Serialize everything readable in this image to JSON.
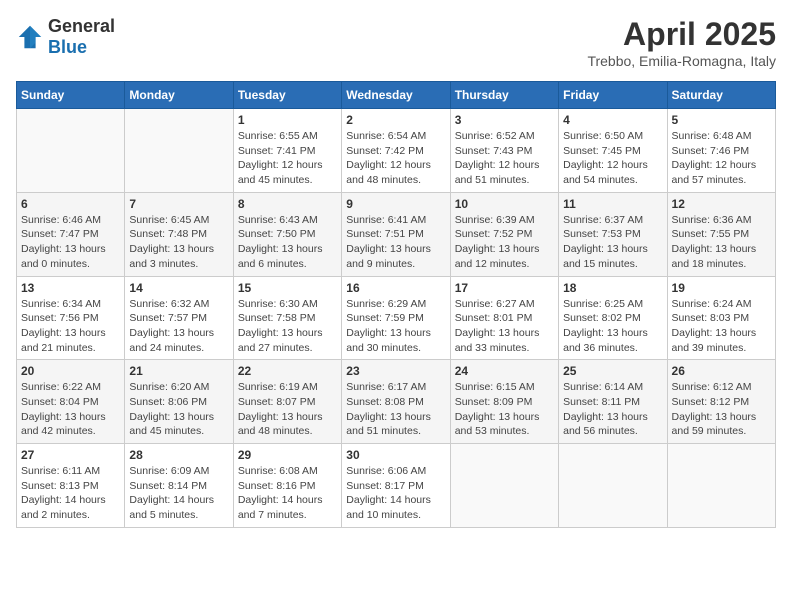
{
  "header": {
    "logo": {
      "general": "General",
      "blue": "Blue"
    },
    "title": "April 2025",
    "location": "Trebbo, Emilia-Romagna, Italy"
  },
  "weekdays": [
    "Sunday",
    "Monday",
    "Tuesday",
    "Wednesday",
    "Thursday",
    "Friday",
    "Saturday"
  ],
  "weeks": [
    [
      {
        "day": "",
        "info": ""
      },
      {
        "day": "",
        "info": ""
      },
      {
        "day": "1",
        "info": "Sunrise: 6:55 AM\nSunset: 7:41 PM\nDaylight: 12 hours\nand 45 minutes."
      },
      {
        "day": "2",
        "info": "Sunrise: 6:54 AM\nSunset: 7:42 PM\nDaylight: 12 hours\nand 48 minutes."
      },
      {
        "day": "3",
        "info": "Sunrise: 6:52 AM\nSunset: 7:43 PM\nDaylight: 12 hours\nand 51 minutes."
      },
      {
        "day": "4",
        "info": "Sunrise: 6:50 AM\nSunset: 7:45 PM\nDaylight: 12 hours\nand 54 minutes."
      },
      {
        "day": "5",
        "info": "Sunrise: 6:48 AM\nSunset: 7:46 PM\nDaylight: 12 hours\nand 57 minutes."
      }
    ],
    [
      {
        "day": "6",
        "info": "Sunrise: 6:46 AM\nSunset: 7:47 PM\nDaylight: 13 hours\nand 0 minutes."
      },
      {
        "day": "7",
        "info": "Sunrise: 6:45 AM\nSunset: 7:48 PM\nDaylight: 13 hours\nand 3 minutes."
      },
      {
        "day": "8",
        "info": "Sunrise: 6:43 AM\nSunset: 7:50 PM\nDaylight: 13 hours\nand 6 minutes."
      },
      {
        "day": "9",
        "info": "Sunrise: 6:41 AM\nSunset: 7:51 PM\nDaylight: 13 hours\nand 9 minutes."
      },
      {
        "day": "10",
        "info": "Sunrise: 6:39 AM\nSunset: 7:52 PM\nDaylight: 13 hours\nand 12 minutes."
      },
      {
        "day": "11",
        "info": "Sunrise: 6:37 AM\nSunset: 7:53 PM\nDaylight: 13 hours\nand 15 minutes."
      },
      {
        "day": "12",
        "info": "Sunrise: 6:36 AM\nSunset: 7:55 PM\nDaylight: 13 hours\nand 18 minutes."
      }
    ],
    [
      {
        "day": "13",
        "info": "Sunrise: 6:34 AM\nSunset: 7:56 PM\nDaylight: 13 hours\nand 21 minutes."
      },
      {
        "day": "14",
        "info": "Sunrise: 6:32 AM\nSunset: 7:57 PM\nDaylight: 13 hours\nand 24 minutes."
      },
      {
        "day": "15",
        "info": "Sunrise: 6:30 AM\nSunset: 7:58 PM\nDaylight: 13 hours\nand 27 minutes."
      },
      {
        "day": "16",
        "info": "Sunrise: 6:29 AM\nSunset: 7:59 PM\nDaylight: 13 hours\nand 30 minutes."
      },
      {
        "day": "17",
        "info": "Sunrise: 6:27 AM\nSunset: 8:01 PM\nDaylight: 13 hours\nand 33 minutes."
      },
      {
        "day": "18",
        "info": "Sunrise: 6:25 AM\nSunset: 8:02 PM\nDaylight: 13 hours\nand 36 minutes."
      },
      {
        "day": "19",
        "info": "Sunrise: 6:24 AM\nSunset: 8:03 PM\nDaylight: 13 hours\nand 39 minutes."
      }
    ],
    [
      {
        "day": "20",
        "info": "Sunrise: 6:22 AM\nSunset: 8:04 PM\nDaylight: 13 hours\nand 42 minutes."
      },
      {
        "day": "21",
        "info": "Sunrise: 6:20 AM\nSunset: 8:06 PM\nDaylight: 13 hours\nand 45 minutes."
      },
      {
        "day": "22",
        "info": "Sunrise: 6:19 AM\nSunset: 8:07 PM\nDaylight: 13 hours\nand 48 minutes."
      },
      {
        "day": "23",
        "info": "Sunrise: 6:17 AM\nSunset: 8:08 PM\nDaylight: 13 hours\nand 51 minutes."
      },
      {
        "day": "24",
        "info": "Sunrise: 6:15 AM\nSunset: 8:09 PM\nDaylight: 13 hours\nand 53 minutes."
      },
      {
        "day": "25",
        "info": "Sunrise: 6:14 AM\nSunset: 8:11 PM\nDaylight: 13 hours\nand 56 minutes."
      },
      {
        "day": "26",
        "info": "Sunrise: 6:12 AM\nSunset: 8:12 PM\nDaylight: 13 hours\nand 59 minutes."
      }
    ],
    [
      {
        "day": "27",
        "info": "Sunrise: 6:11 AM\nSunset: 8:13 PM\nDaylight: 14 hours\nand 2 minutes."
      },
      {
        "day": "28",
        "info": "Sunrise: 6:09 AM\nSunset: 8:14 PM\nDaylight: 14 hours\nand 5 minutes."
      },
      {
        "day": "29",
        "info": "Sunrise: 6:08 AM\nSunset: 8:16 PM\nDaylight: 14 hours\nand 7 minutes."
      },
      {
        "day": "30",
        "info": "Sunrise: 6:06 AM\nSunset: 8:17 PM\nDaylight: 14 hours\nand 10 minutes."
      },
      {
        "day": "",
        "info": ""
      },
      {
        "day": "",
        "info": ""
      },
      {
        "day": "",
        "info": ""
      }
    ]
  ]
}
